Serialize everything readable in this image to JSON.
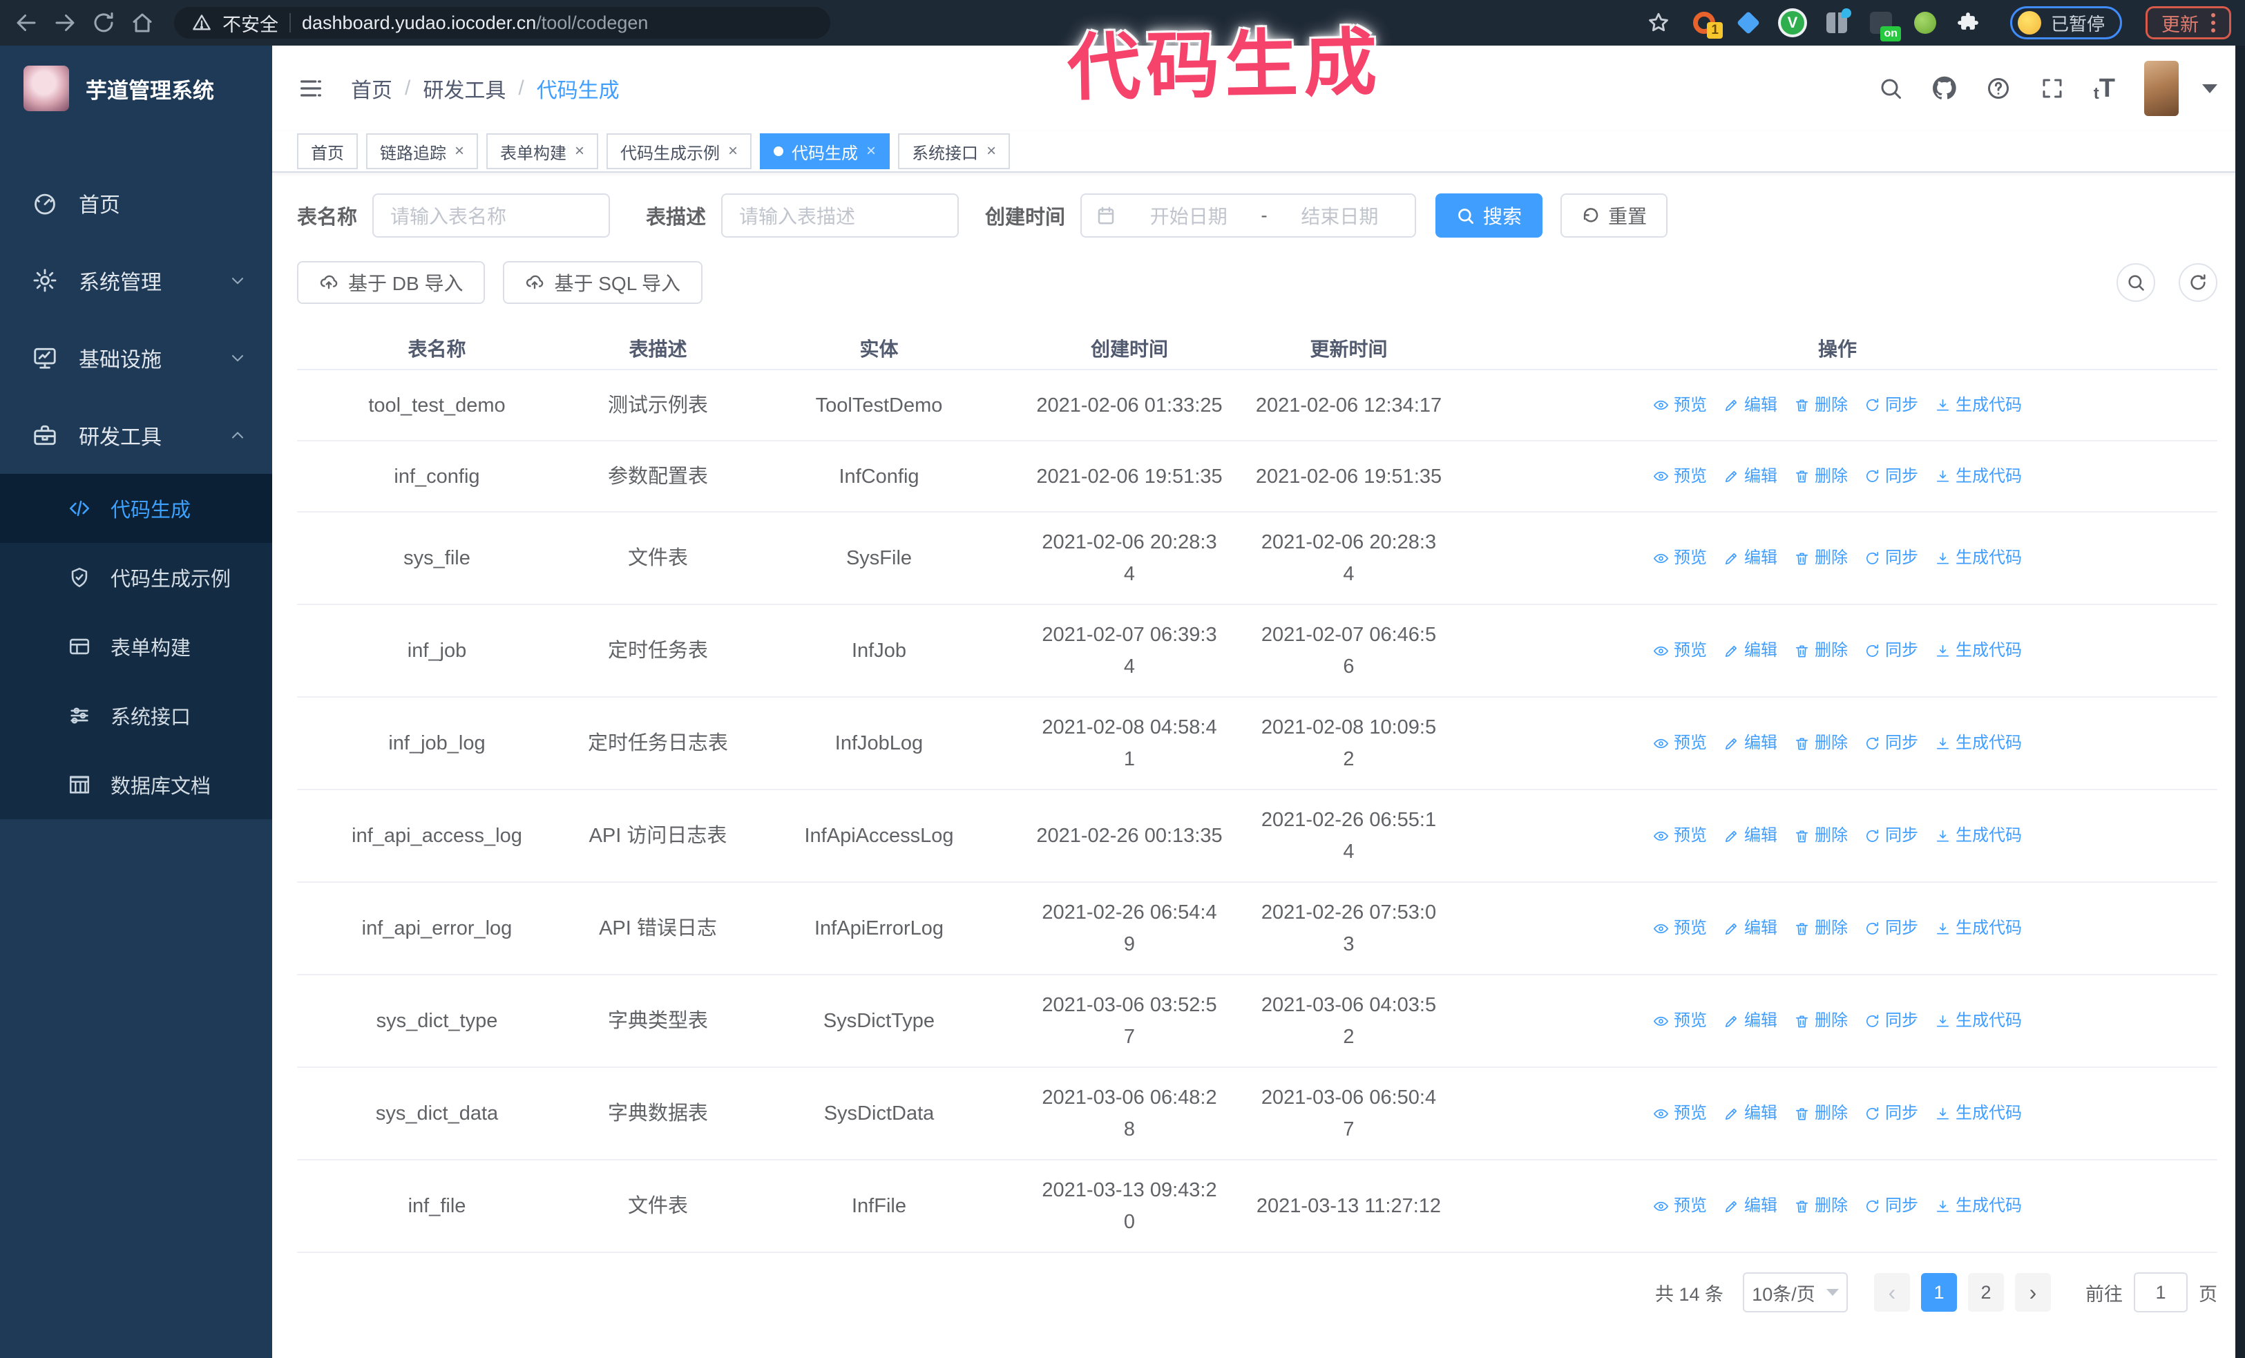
{
  "browser": {
    "security_label": "不安全",
    "url_host": "dashboard.yudao.iocoder.cn",
    "url_path": "/tool/codegen",
    "ext_badge_count": "1",
    "ext_v_label": "V",
    "ext_badge_on": "on",
    "paused_badge": "已暂停",
    "update_button": "更新"
  },
  "annotation": {
    "text": "代码生成",
    "color": "#f5436b"
  },
  "sidebar": {
    "title": "芋道管理系统",
    "items": [
      {
        "key": "home",
        "label": "首页",
        "icon": "dashboard-icon"
      },
      {
        "key": "system",
        "label": "系统管理",
        "icon": "gear-icon",
        "chevron": "down"
      },
      {
        "key": "infra",
        "label": "基础设施",
        "icon": "monitor-icon",
        "chevron": "down"
      },
      {
        "key": "devtools",
        "label": "研发工具",
        "icon": "toolbox-icon",
        "chevron": "up",
        "expanded": true
      }
    ],
    "subitems": [
      {
        "key": "codegen",
        "label": "代码生成",
        "icon": "code-icon",
        "active": true
      },
      {
        "key": "codegen-demo",
        "label": "代码生成示例",
        "icon": "shield-check-icon"
      },
      {
        "key": "form-builder",
        "label": "表单构建",
        "icon": "form-icon"
      },
      {
        "key": "system-api",
        "label": "系统接口",
        "icon": "sliders-icon"
      },
      {
        "key": "db-doc",
        "label": "数据库文档",
        "icon": "database-icon"
      }
    ]
  },
  "header": {
    "breadcrumb": [
      "首页",
      "研发工具",
      "代码生成"
    ],
    "fontsize_label_small": "t",
    "fontsize_label_big": "T"
  },
  "tabs": [
    {
      "key": "home",
      "label": "首页",
      "closable": false,
      "active": false
    },
    {
      "key": "tracing",
      "label": "链路追踪",
      "closable": true,
      "active": false
    },
    {
      "key": "form-builder",
      "label": "表单构建",
      "closable": true,
      "active": false
    },
    {
      "key": "codegen-demo",
      "label": "代码生成示例",
      "closable": true,
      "active": false
    },
    {
      "key": "codegen",
      "label": "代码生成",
      "closable": true,
      "active": true
    },
    {
      "key": "system-api",
      "label": "系统接口",
      "closable": true,
      "active": false
    }
  ],
  "search": {
    "name_label": "表名称",
    "name_placeholder": "请输入表名称",
    "desc_label": "表描述",
    "desc_placeholder": "请输入表描述",
    "time_label": "创建时间",
    "start_placeholder": "开始日期",
    "range_separator": "-",
    "end_placeholder": "结束日期",
    "search_button": "搜索",
    "reset_button": "重置"
  },
  "toolbar": {
    "import_db": "基于 DB 导入",
    "import_sql": "基于 SQL 导入"
  },
  "table": {
    "headers": [
      "表名称",
      "表描述",
      "实体",
      "创建时间",
      "更新时间",
      "操作"
    ],
    "actions": [
      {
        "key": "preview",
        "label": "预览",
        "icon": "eye-icon"
      },
      {
        "key": "edit",
        "label": "编辑",
        "icon": "edit-icon"
      },
      {
        "key": "delete",
        "label": "删除",
        "icon": "delete-icon"
      },
      {
        "key": "sync",
        "label": "同步",
        "icon": "sync-icon"
      },
      {
        "key": "generate",
        "label": "生成代码",
        "icon": "download-icon"
      }
    ],
    "rows": [
      {
        "name": "tool_test_demo",
        "desc": "测试示例表",
        "entity": "ToolTestDemo",
        "created": [
          "2021-02-06 01:33:25"
        ],
        "updated": [
          "2021-02-06 12:34:17"
        ]
      },
      {
        "name": "inf_config",
        "desc": "参数配置表",
        "entity": "InfConfig",
        "created": [
          "2021-02-06 19:51:35"
        ],
        "updated": [
          "2021-02-06 19:51:35"
        ]
      },
      {
        "name": "sys_file",
        "desc": "文件表",
        "entity": "SysFile",
        "created": [
          "2021-02-06 20:28:3",
          "4"
        ],
        "updated": [
          "2021-02-06 20:28:3",
          "4"
        ]
      },
      {
        "name": "inf_job",
        "desc": "定时任务表",
        "entity": "InfJob",
        "created": [
          "2021-02-07 06:39:3",
          "4"
        ],
        "updated": [
          "2021-02-07 06:46:5",
          "6"
        ]
      },
      {
        "name": "inf_job_log",
        "desc": "定时任务日志表",
        "entity": "InfJobLog",
        "created": [
          "2021-02-08 04:58:4",
          "1"
        ],
        "updated": [
          "2021-02-08 10:09:5",
          "2"
        ]
      },
      {
        "name": "inf_api_access_log",
        "desc": "API 访问日志表",
        "entity": "InfApiAccessLog",
        "created": [
          "2021-02-26 00:13:35"
        ],
        "updated": [
          "2021-02-26 06:55:1",
          "4"
        ]
      },
      {
        "name": "inf_api_error_log",
        "desc": "API 错误日志",
        "entity": "InfApiErrorLog",
        "created": [
          "2021-02-26 06:54:4",
          "9"
        ],
        "updated": [
          "2021-02-26 07:53:0",
          "3"
        ]
      },
      {
        "name": "sys_dict_type",
        "desc": "字典类型表",
        "entity": "SysDictType",
        "created": [
          "2021-03-06 03:52:5",
          "7"
        ],
        "updated": [
          "2021-03-06 04:03:5",
          "2"
        ]
      },
      {
        "name": "sys_dict_data",
        "desc": "字典数据表",
        "entity": "SysDictData",
        "created": [
          "2021-03-06 06:48:2",
          "8"
        ],
        "updated": [
          "2021-03-06 06:50:4",
          "7"
        ]
      },
      {
        "name": "inf_file",
        "desc": "文件表",
        "entity": "InfFile",
        "created": [
          "2021-03-13 09:43:2",
          "0"
        ],
        "updated": [
          "2021-03-13 11:27:12"
        ]
      }
    ]
  },
  "pagination": {
    "total": "共 14 条",
    "page_size": "10条/页",
    "pages": [
      "1",
      "2"
    ],
    "active_page": "1",
    "goto_label": "前往",
    "goto_value": "1",
    "page_unit": "页"
  },
  "colors": {
    "primary": "#409eff",
    "sidebar_bg": "#1e3a57",
    "submenu_bg": "#132c44",
    "browser_bar": "#1e2936",
    "annotation": "#f5436b"
  }
}
